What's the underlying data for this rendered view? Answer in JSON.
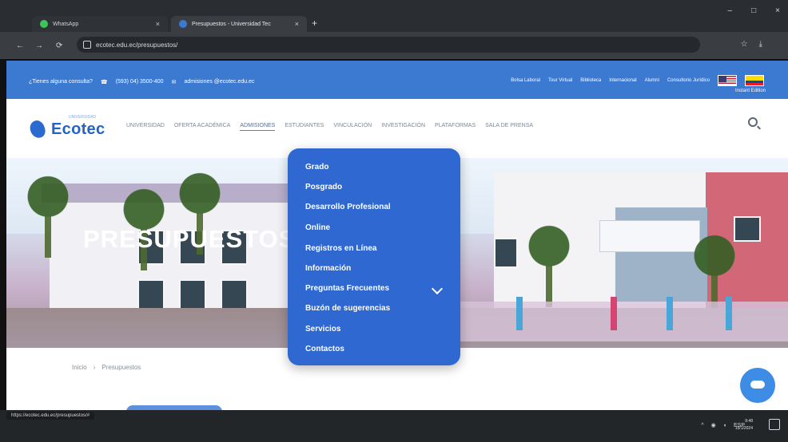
{
  "browser": {
    "tabs": [
      {
        "label": "WhatsApp",
        "active": false
      },
      {
        "label": "Presupuestos - Universidad Tec",
        "active": true
      }
    ],
    "url": "ecotec.edu.ec/presupuestos/",
    "new_tab": "+",
    "status_url": "https://ecotec.edu.ec/presupuestos/#"
  },
  "topbar": {
    "contact_prefix": "¿Tienes alguna consulta?",
    "phone": "(593) 04) 3500-400",
    "email": "admisiones @ecotec.edu.ec",
    "links": [
      "Bolsa Laboral",
      "Tour Virtual",
      "Biblioteca",
      "Internacional",
      "Alumni",
      "Consultorio Jurídico"
    ],
    "instant": "Instant Edition"
  },
  "logo": {
    "text": "Ecotec",
    "sub": "UNIVERSIDAD"
  },
  "nav": {
    "items": [
      "UNIVERSIDAD",
      "OFERTA ACADÉMICA",
      "ADMISIONES",
      "ESTUDIANTES",
      "VINCULACIÓN",
      "INVESTIGACIÓN",
      "PLATAFORMAS",
      "SALA DE PRENSA"
    ],
    "active": "ADMISIONES"
  },
  "hero": {
    "title": "PRESUPUESTOS"
  },
  "breadcrumb": {
    "home": "Inicio",
    "current": "Presupuestos"
  },
  "dropdown": {
    "items": [
      "Grado",
      "Posgrado",
      "Desarrollo Profesional",
      "Online",
      "Registros en Línea",
      "Información",
      "Preguntas Frecuentes",
      "Buzón de sugerencias",
      "Servicios",
      "Contactos"
    ],
    "open_item": "Preguntas Frecuentes"
  },
  "taskbar": {
    "language": "ESP",
    "time": "9:48",
    "date": "15/1/2024"
  },
  "colors": {
    "brand_blue": "#3c79d1",
    "dropdown_blue": "#2e68d0"
  }
}
